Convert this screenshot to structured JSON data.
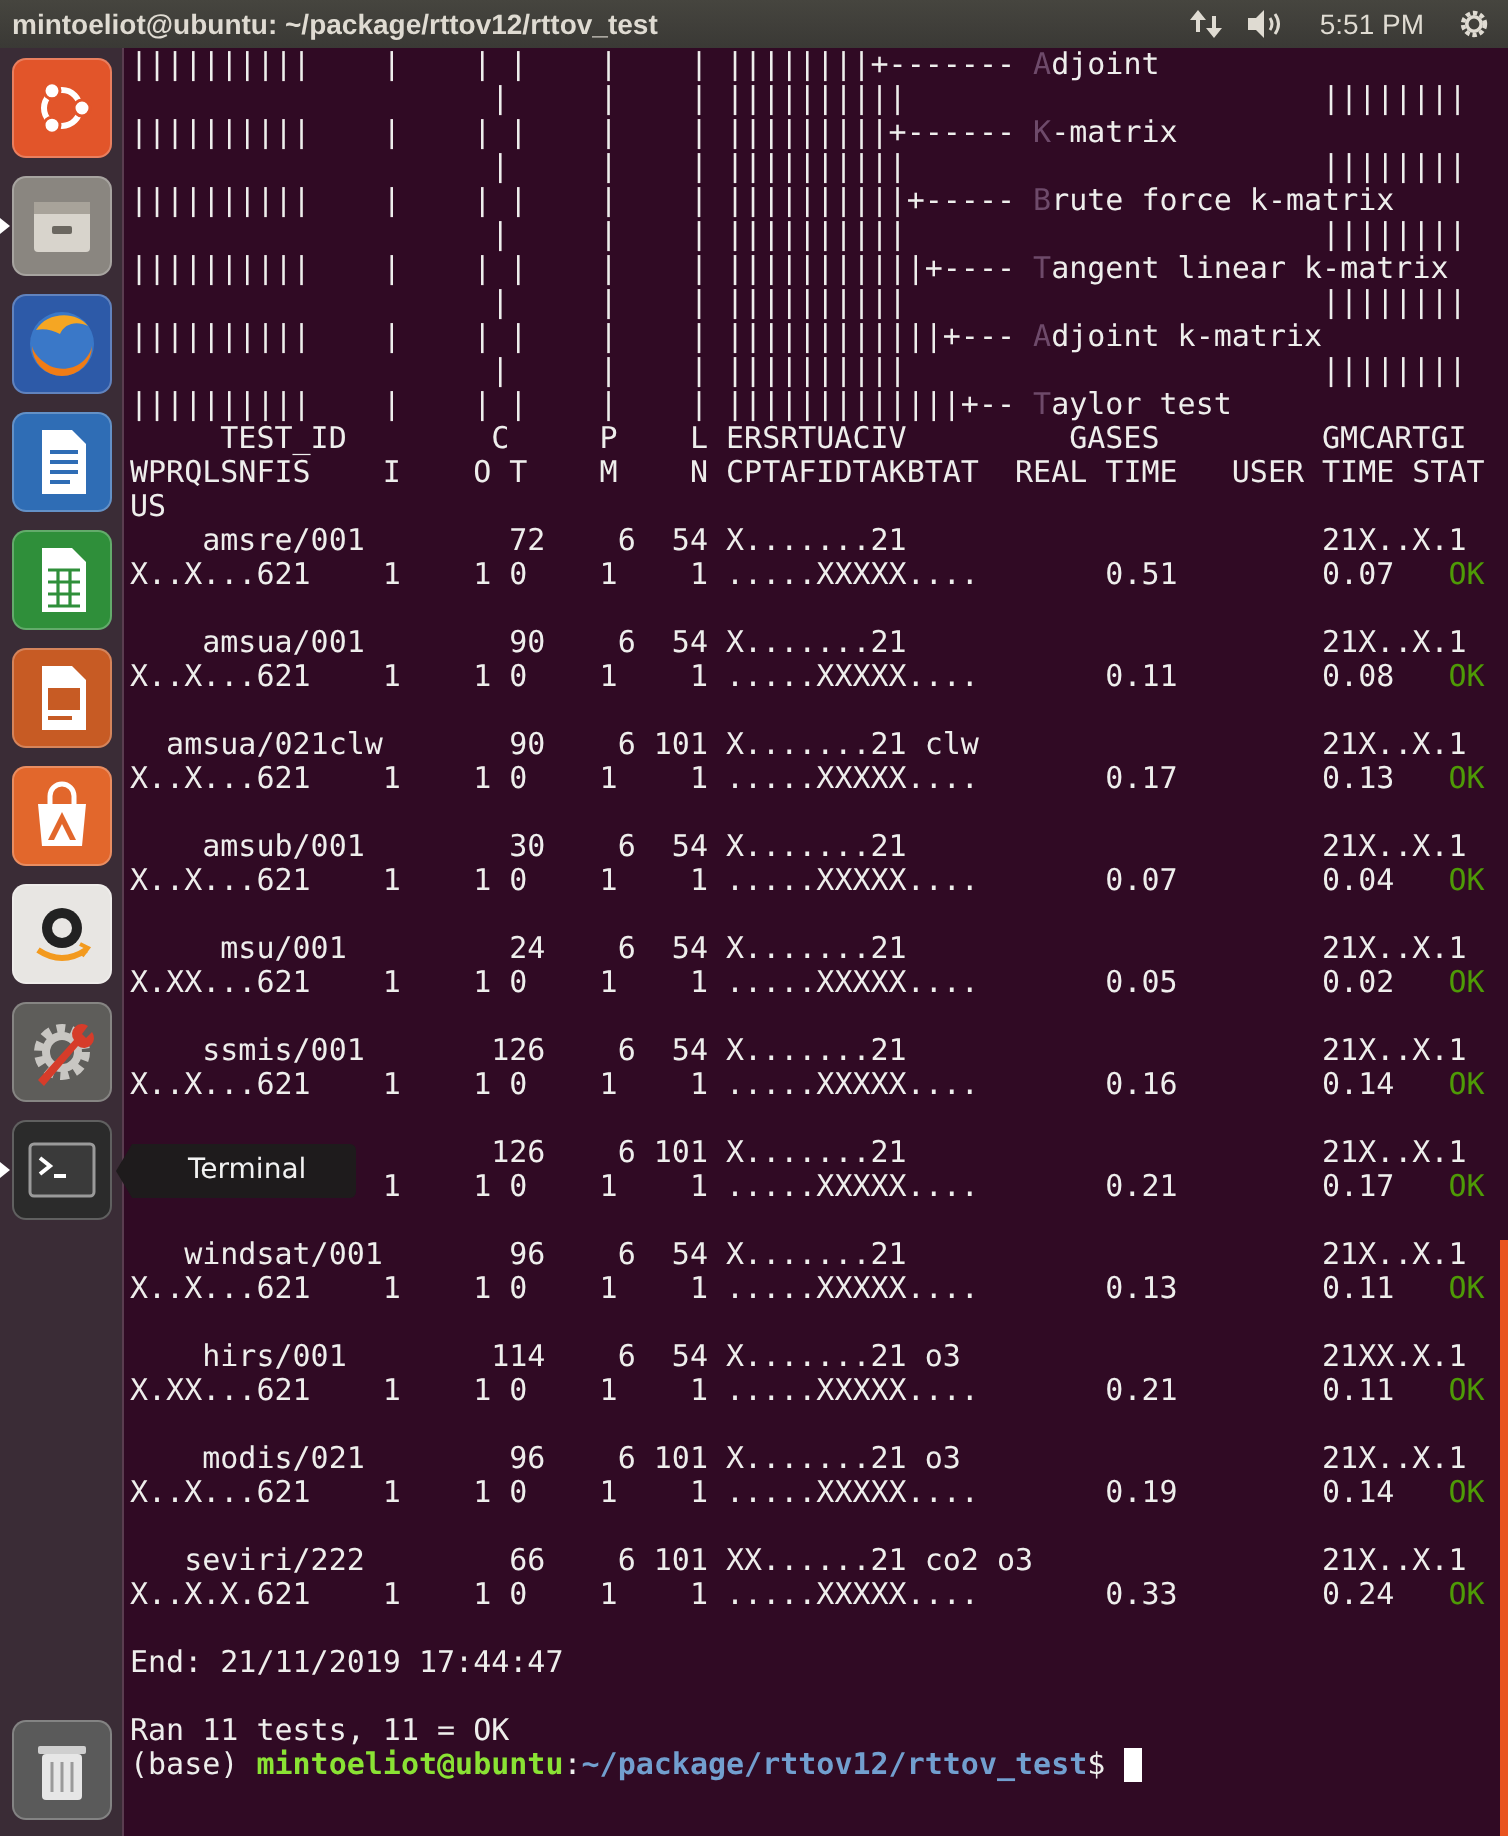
{
  "panel": {
    "title": "mintoeliot@ubuntu: ~/package/rttov12/rttov_test",
    "clock": "5:51 PM"
  },
  "launcher": {
    "items": [
      {
        "kind": "dash",
        "running": false
      },
      {
        "kind": "files",
        "running": true
      },
      {
        "kind": "browser",
        "running": false
      },
      {
        "kind": "writer",
        "running": false
      },
      {
        "kind": "calc",
        "running": false
      },
      {
        "kind": "impress",
        "running": false
      },
      {
        "kind": "software",
        "running": false
      },
      {
        "kind": "shop",
        "running": false
      },
      {
        "kind": "settings",
        "running": false
      },
      {
        "kind": "terminal",
        "running": true,
        "tooltip": "Terminal"
      },
      {
        "kind": "trash",
        "running": false
      }
    ]
  },
  "terminal": {
    "header_lines": [
      [
        {
          "text": "||||||||||    |    | |    |    | ||||||||+------- ",
          "dim": false
        },
        {
          "text": "A",
          "dim": true
        },
        {
          "text": "djoint",
          "dim": false
        }
      ],
      [
        {
          "text": "                    |     |    | ||||||||||                       ||||||||",
          "dim": false
        }
      ],
      [
        {
          "text": "||||||||||    |    | |    |    | |||||||||+------ ",
          "dim": false
        },
        {
          "text": "K",
          "dim": true
        },
        {
          "text": "-matrix",
          "dim": false
        }
      ],
      [
        {
          "text": "                    |     |    | ||||||||||                       ||||||||",
          "dim": false
        }
      ],
      [
        {
          "text": "||||||||||    |    | |    |    | ||||||||||+----- ",
          "dim": false
        },
        {
          "text": "B",
          "dim": true
        },
        {
          "text": "rute force k-matrix",
          "dim": false
        }
      ],
      [
        {
          "text": "                    |     |    | ||||||||||                       ||||||||",
          "dim": false
        }
      ],
      [
        {
          "text": "||||||||||    |    | |    |    | |||||||||||+---- ",
          "dim": false
        },
        {
          "text": "T",
          "dim": true
        },
        {
          "text": "angent linear k-matrix",
          "dim": false
        }
      ],
      [
        {
          "text": "                    |     |    | ||||||||||                       ||||||||",
          "dim": false
        }
      ],
      [
        {
          "text": "||||||||||    |    | |    |    | ||||||||||||+--- ",
          "dim": false
        },
        {
          "text": "A",
          "dim": true
        },
        {
          "text": "djoint k-matrix",
          "dim": false
        }
      ],
      [
        {
          "text": "                    |     |    | ||||||||||                       ||||||||",
          "dim": false
        }
      ],
      [
        {
          "text": "||||||||||    |    | |    |    | |||||||||||||+-- ",
          "dim": false
        },
        {
          "text": "T",
          "dim": true
        },
        {
          "text": "aylor test",
          "dim": false
        }
      ],
      [
        {
          "text": "     TEST_ID        C     P    L ERSRTUACIV         GASES         GMCARTGI",
          "dim": false
        }
      ],
      [
        {
          "text": "WPRQLSNFIS    I    O T    M    N CPTAFIDTAKBTAT  REAL TIME   USER TIME STAT",
          "dim": false
        }
      ],
      [
        {
          "text": "US",
          "dim": false
        }
      ]
    ],
    "tests": [
      {
        "name_line": "    amsre/001        72    6  54 X.......21",
        "flags": "21X..X.1",
        "result_line": "X..X...621    1    1 0    1    1 .....XXXXX....       0.51        0.07",
        "status": "OK"
      },
      {
        "name_line": "    amsua/001        90    6  54 X.......21",
        "flags": "21X..X.1",
        "result_line": "X..X...621    1    1 0    1    1 .....XXXXX....       0.11        0.08",
        "status": "OK"
      },
      {
        "name_line": "  amsua/021clw       90    6 101 X.......21 clw",
        "flags": "21X..X.1",
        "result_line": "X..X...621    1    1 0    1    1 .....XXXXX....       0.17        0.13",
        "status": "OK"
      },
      {
        "name_line": "    amsub/001        30    6  54 X.......21",
        "flags": "21X..X.1",
        "result_line": "X..X...621    1    1 0    1    1 .....XXXXX....       0.07        0.04",
        "status": "OK"
      },
      {
        "name_line": "     msu/001         24    6  54 X.......21",
        "flags": "21X..X.1",
        "result_line": "X.XX...621    1    1 0    1    1 .....XXXXX....       0.05        0.02",
        "status": "OK"
      },
      {
        "name_line": "    ssmis/001       126    6  54 X.......21",
        "flags": "21X..X.1",
        "result_line": "X..X...621    1    1 0    1    1 .....XXXXX....       0.16        0.14",
        "status": "OK"
      },
      {
        "name_line": "                    126    6 101 X.......21",
        "flags": "21X..X.1",
        "result_line": "              1    1 0    1    1 .....XXXXX....       0.21        0.17",
        "status": "OK"
      },
      {
        "name_line": "   windsat/001       96    6  54 X.......21",
        "flags": "21X..X.1",
        "result_line": "X..X...621    1    1 0    1    1 .....XXXXX....       0.13        0.11",
        "status": "OK"
      },
      {
        "name_line": "    hirs/001        114    6  54 X.......21 o3",
        "flags": "21XX.X.1",
        "result_line": "X.XX...621    1    1 0    1    1 .....XXXXX....       0.21        0.11",
        "status": "OK"
      },
      {
        "name_line": "    modis/021        96    6 101 X.......21 o3",
        "flags": "21X..X.1",
        "result_line": "X..X...621    1    1 0    1    1 .....XXXXX....       0.19        0.14",
        "status": "OK"
      },
      {
        "name_line": "   seviri/222        66    6 101 XX......21 co2 o3",
        "flags": "21X..X.1",
        "result_line": "X..X.X.621    1    1 0    1    1 .....XXXXX....       0.33        0.24",
        "status": "OK"
      }
    ],
    "end_line": "End: 21/11/2019 17:44:47",
    "summary": "Ran 11 tests, 11 = OK",
    "prompt": {
      "env": "(base)",
      "user": "mintoeliot@ubuntu",
      "separator": ":",
      "path": "~/package/rttov12/rttov_test",
      "symbol": "$"
    }
  }
}
